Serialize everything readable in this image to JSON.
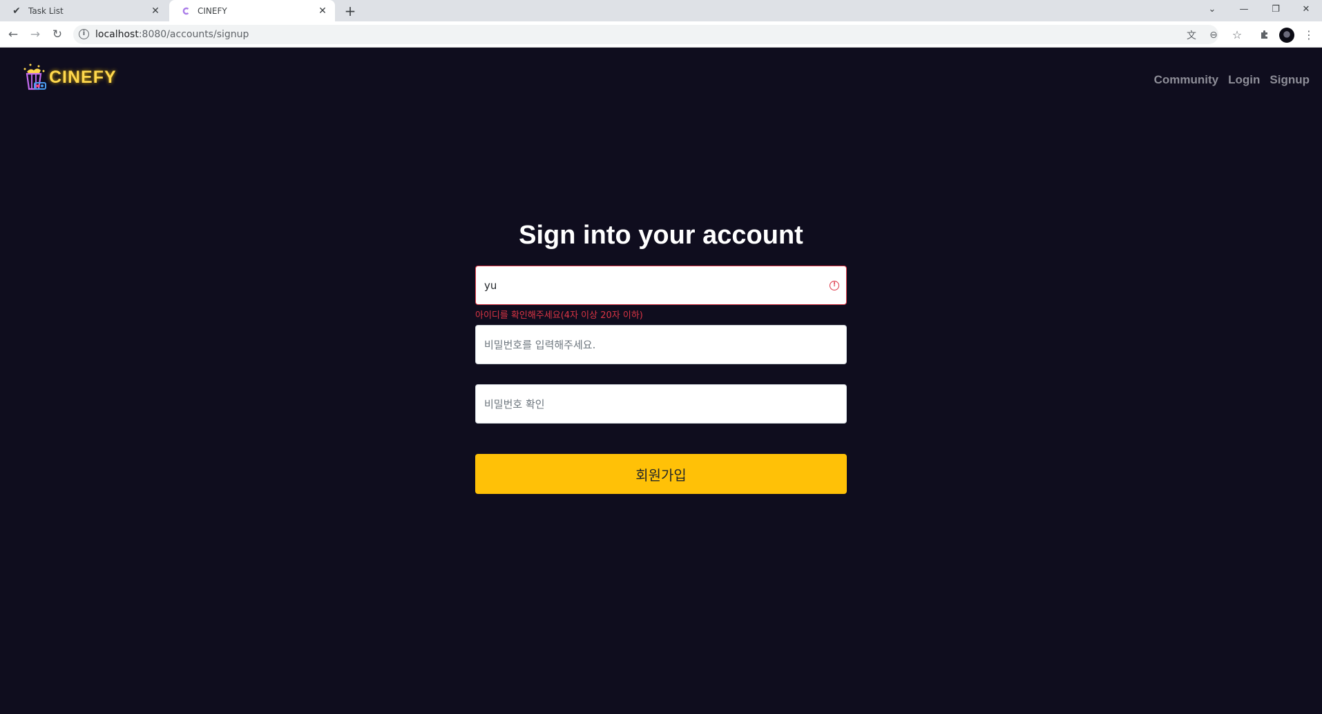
{
  "browser": {
    "tabs": [
      {
        "title": "Task List",
        "icon": "checkmark-icon"
      },
      {
        "title": "CINEFY",
        "icon": "cinefy-favicon"
      }
    ],
    "url_host": "localhost",
    "url_path": ":8080/accounts/signup"
  },
  "header": {
    "logo_text": "CINEFY",
    "nav": [
      "Community",
      "Login",
      "Signup"
    ]
  },
  "form": {
    "title": "Sign into your account",
    "username_value": "yu",
    "username_error": "아이디를 확인해주세요(4자 이상 20자 이하)",
    "password_placeholder": "비밀번호를 입력해주세요.",
    "password_confirm_placeholder": "비밀번호 확인",
    "submit_label": "회원가입"
  },
  "colors": {
    "page_bg": "#0f0d1e",
    "accent": "#ffc107",
    "error": "#dc3545",
    "logo": "#ffd84d"
  }
}
